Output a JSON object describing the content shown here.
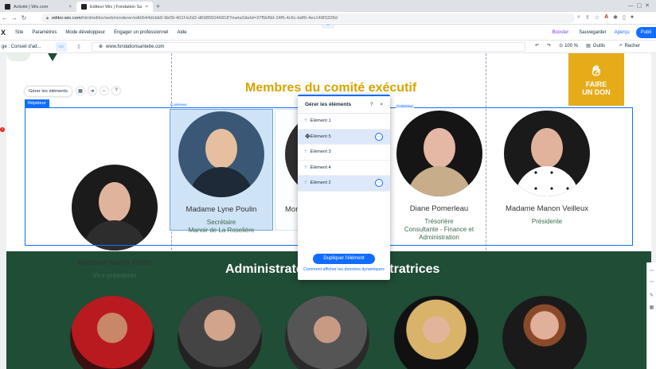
{
  "browser": {
    "tabs": [
      {
        "label": "Activité | Wix.com",
        "active": false
      },
      {
        "label": "Éditeur Wix | Fondation Santé",
        "active": true
      }
    ],
    "new_tab": "+",
    "url_host": "editor.wix.com",
    "url_path": "/html/editor/web/renderer/edit/b44dcbb9-9b09-401f-b2d2-d69855046818?metaSiteId=37f5bf9d-24f6-4c6c-bdf0-4ec149f3328d"
  },
  "wix_top": {
    "logo": "X",
    "menu": [
      "Site",
      "Paramètres",
      "Mode développeur",
      "Engager un professionnel",
      "Aide"
    ],
    "booster": "Booster",
    "save": "Sauvegarder",
    "preview": "Aperçu",
    "publish": "Publi"
  },
  "wix_second": {
    "page": "ge : Conseil d'ad...",
    "site_url": "www.fondationsantebe.com",
    "zoom": "100 %",
    "tools": "Outils",
    "search": "Recher"
  },
  "page": {
    "exec_heading": "Membres du comité exécutif",
    "donate": {
      "line1": "FAIRE",
      "line2": "UN DON"
    },
    "admin_heading": "Administrateurs et administratrices",
    "members": [
      {
        "name": "Madame Nancy Fortin",
        "role": "Vice-présidente"
      },
      {
        "name": "Madame Lyne Poulin",
        "role": "Secrétaire\nManoir de La Roselière"
      },
      {
        "name": "Mon",
        "role": ""
      },
      {
        "name": "Diane Pomerleau",
        "role": "Trésorière\nConsultante - Finance et\nAdministration"
      },
      {
        "name": "Madame Manon Veilleux",
        "role": "Présidente"
      }
    ]
  },
  "editor_overlay": {
    "manage_button": "Gérer les éléments",
    "repeater_tag": "Répéteur",
    "container_tag": "Conteneur",
    "container_tag2": "Conteneur",
    "red_badge": "2"
  },
  "panel": {
    "title": "Gérer les éléments",
    "help": "?",
    "close": "×",
    "items": [
      {
        "label": "Élément 1",
        "highlight": false,
        "more": false
      },
      {
        "label": "Élément 5",
        "highlight": true,
        "more": true
      },
      {
        "label": "Élément 3",
        "highlight": false,
        "more": false
      },
      {
        "label": "Élément 4",
        "highlight": false,
        "more": false
      },
      {
        "label": "Élément 2",
        "highlight": true,
        "more": true
      }
    ],
    "more_glyph": "···",
    "duplicate": "Dupliquer l'élément",
    "dynamic_link": "Comment afficher les données dynamiques"
  },
  "colors": {
    "wix_blue": "#116dff",
    "gold": "#d8a400",
    "green": "#1f4d35"
  }
}
